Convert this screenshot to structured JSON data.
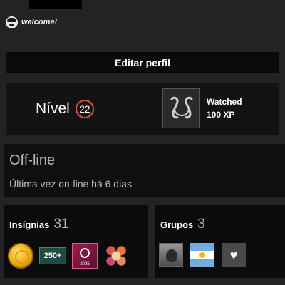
{
  "profile": {
    "status_text": "welcome!",
    "edit_button_label": "Editar perfil"
  },
  "level": {
    "label": "Nível",
    "value": "22"
  },
  "featured_badge": {
    "name": "Watched",
    "xp": "100 XP",
    "icon": "watched-badge-icon"
  },
  "presence": {
    "status": "Off-line",
    "last_online": "Última vez on-line há 6 dias"
  },
  "badges": {
    "title": "Insígnias",
    "count": "31",
    "items": [
      {
        "icon": "gold-coin-badge-icon"
      },
      {
        "icon": "years-of-service-badge-icon",
        "text": "250+"
      },
      {
        "icon": "steam-2025-badge-icon",
        "text": "2025"
      },
      {
        "icon": "flower-badge-icon"
      }
    ]
  },
  "groups": {
    "title": "Grupos",
    "count": "3",
    "items": [
      {
        "icon": "group-avatar-icon"
      },
      {
        "icon": "argentina-flag-icon"
      },
      {
        "icon": "heart-group-icon"
      }
    ]
  },
  "colors": {
    "background": "#232323",
    "panel": "#0b0b0b",
    "level_ring": "#d9523a",
    "text": "#ffffff",
    "muted_text": "#b8b8b8"
  }
}
